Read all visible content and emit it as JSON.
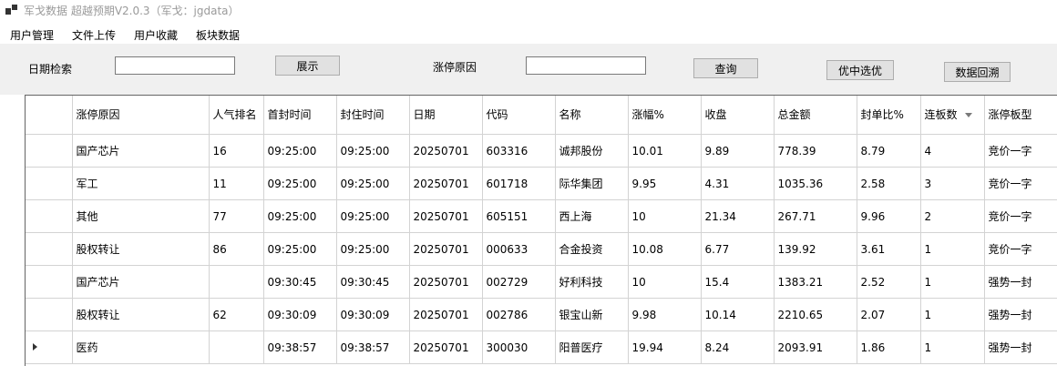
{
  "window": {
    "title": "军戈数据 超越预期V2.0.3（军戈：jgdata）"
  },
  "menu": {
    "items": [
      "用户管理",
      "文件上传",
      "用户收藏",
      "板块数据"
    ]
  },
  "toolbar": {
    "date_label": "日期检索",
    "date_value": "",
    "show_button": "展示",
    "reason_label": "涨停原因",
    "reason_value": "",
    "query_button": "查询",
    "pick_button": "优中选优",
    "backtrack_button": "数据回溯"
  },
  "grid": {
    "columns": [
      "涨停原因",
      "人气排名",
      "首封时间",
      "封住时间",
      "日期",
      "代码",
      "名称",
      "涨幅%",
      "收盘",
      "总金额",
      "封单比%",
      "连板数",
      "涨停板型"
    ],
    "sorted_column": "连板数",
    "sort_direction": "descending",
    "current_row": 7,
    "rows": [
      [
        "国产芯片",
        "16",
        "09:25:00",
        "09:25:00",
        "20250701",
        "603316",
        "诚邦股份",
        "10.01",
        "9.89",
        "778.39",
        "8.79",
        "4",
        "竞价一字"
      ],
      [
        "军工",
        "11",
        "09:25:00",
        "09:25:00",
        "20250701",
        "601718",
        "际华集团",
        "9.95",
        "4.31",
        "1035.36",
        "2.58",
        "3",
        "竞价一字"
      ],
      [
        "其他",
        "77",
        "09:25:00",
        "09:25:00",
        "20250701",
        "605151",
        "西上海",
        "10",
        "21.34",
        "267.71",
        "9.96",
        "2",
        "竞价一字"
      ],
      [
        "股权转让",
        "86",
        "09:25:00",
        "09:25:00",
        "20250701",
        "000633",
        "合金投资",
        "10.08",
        "6.77",
        "139.92",
        "3.61",
        "1",
        "竞价一字"
      ],
      [
        "国产芯片",
        "",
        "09:30:45",
        "09:30:45",
        "20250701",
        "002729",
        "好利科技",
        "10",
        "15.4",
        "1383.21",
        "2.52",
        "1",
        "强势一封"
      ],
      [
        "股权转让",
        "62",
        "09:30:09",
        "09:30:09",
        "20250701",
        "002786",
        "银宝山新",
        "9.98",
        "10.14",
        "2210.65",
        "2.07",
        "1",
        "强势一封"
      ],
      [
        "医药",
        "",
        "09:38:57",
        "09:38:57",
        "20250701",
        "300030",
        "阳普医疗",
        "19.94",
        "8.24",
        "2093.91",
        "1.86",
        "1",
        "强势一封"
      ]
    ]
  }
}
